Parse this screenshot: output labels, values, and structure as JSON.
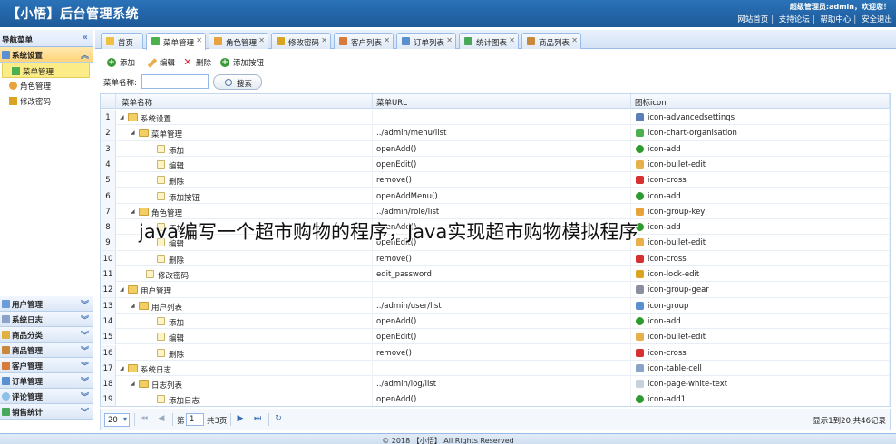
{
  "header": {
    "brand": "【小悟】后台管理系统",
    "user_info": "超级管理员:admin，欢迎您！",
    "links": [
      "网站首页",
      "支持论坛",
      "帮助中心",
      "安全退出"
    ]
  },
  "sidebar": {
    "title": "导航菜单",
    "active_section": "系统设置",
    "items": [
      "菜单管理",
      "角色管理",
      "修改密码"
    ],
    "sections": [
      "用户管理",
      "系统日志",
      "商品分类",
      "商品管理",
      "客户管理",
      "订单管理",
      "评论管理",
      "销售统计"
    ]
  },
  "tabs": [
    "首页",
    "菜单管理",
    "角色管理",
    "修改密码",
    "客户列表",
    "订单列表",
    "统计图表",
    "商品列表"
  ],
  "toolbar": {
    "add": "添加",
    "edit": "编辑",
    "delete": "删除",
    "add_button": "添加按钮"
  },
  "search": {
    "label": "菜单名称:",
    "value": "",
    "button": "搜索"
  },
  "grid": {
    "columns": [
      "菜单名称",
      "菜单URL",
      "图标icon"
    ],
    "rows": [
      {
        "n": "1",
        "name": "系统设置",
        "url": "",
        "icon": "icon-advancedsettings"
      },
      {
        "n": "2",
        "name": "菜单管理",
        "url": "../admin/menu/list",
        "icon": "icon-chart-organisation"
      },
      {
        "n": "3",
        "name": "添加",
        "url": "openAdd()",
        "icon": "icon-add"
      },
      {
        "n": "4",
        "name": "编辑",
        "url": "openEdit()",
        "icon": "icon-bullet-edit"
      },
      {
        "n": "5",
        "name": "删除",
        "url": "remove()",
        "icon": "icon-cross"
      },
      {
        "n": "6",
        "name": "添加按钮",
        "url": "openAddMenu()",
        "icon": "icon-add"
      },
      {
        "n": "7",
        "name": "角色管理",
        "url": "../admin/role/list",
        "icon": "icon-group-key"
      },
      {
        "n": "8",
        "name": "添加",
        "url": "openAdd()",
        "icon": "icon-add"
      },
      {
        "n": "9",
        "name": "编辑",
        "url": "openEdit()",
        "icon": "icon-bullet-edit"
      },
      {
        "n": "10",
        "name": "删除",
        "url": "remove()",
        "icon": "icon-cross"
      },
      {
        "n": "11",
        "name": "修改密码",
        "url": "edit_password",
        "icon": "icon-lock-edit"
      },
      {
        "n": "12",
        "name": "用户管理",
        "url": "",
        "icon": "icon-group-gear"
      },
      {
        "n": "13",
        "name": "用户列表",
        "url": "../admin/user/list",
        "icon": "icon-group"
      },
      {
        "n": "14",
        "name": "添加",
        "url": "openAdd()",
        "icon": "icon-add"
      },
      {
        "n": "15",
        "name": "编辑",
        "url": "openEdit()",
        "icon": "icon-bullet-edit"
      },
      {
        "n": "16",
        "name": "删除",
        "url": "remove()",
        "icon": "icon-cross"
      },
      {
        "n": "17",
        "name": "系统日志",
        "url": "",
        "icon": "icon-table-cell"
      },
      {
        "n": "18",
        "name": "日志列表",
        "url": "../admin/log/list",
        "icon": "icon-page-white-text"
      },
      {
        "n": "19",
        "name": "添加日志",
        "url": "openAdd()",
        "icon": "icon-add1"
      }
    ]
  },
  "pager": {
    "page_size": "20",
    "page_prefix": "第",
    "page": "1",
    "page_suffix": "共3页",
    "info": "显示1到20,共46记录"
  },
  "footer": "© 2018 【小悟】 All Rights Reserved",
  "watermark": "java编写一个超市购物的程序，Java实现超市购物模拟程序"
}
